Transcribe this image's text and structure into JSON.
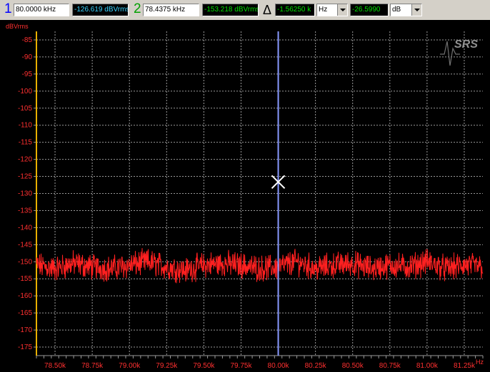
{
  "toolbar": {
    "cursor1": {
      "number": "1",
      "x_value": "80.0000 kHz",
      "y_value": "-126.619 dBVrms"
    },
    "cursor2": {
      "number": "2",
      "x_value": "78.4375 kHz",
      "y_value": "-153.218 dBVrms"
    },
    "delta": {
      "symbol": "Δ",
      "x_value": "-1.56250 k",
      "x_unit": "Hz",
      "y_value": "-26.5990",
      "y_unit": "dB"
    }
  },
  "logo": {
    "text": "SRS"
  },
  "colors": {
    "trace": "#ff2020",
    "grid": "#9a9a9a",
    "cursor_line": "#8899ff",
    "axis_text": "#ff3030",
    "yaxis_line": "#e8b000",
    "cursor1": "#0000ff",
    "cursor2": "#00aa00"
  },
  "chart_data": {
    "type": "line",
    "ylabel": "dBVrms",
    "xlabel": "Hz",
    "xlim": [
      78375,
      81375
    ],
    "ylim": [
      -177.5,
      -82.5
    ],
    "yticks": [
      -85,
      -90,
      -95,
      -100,
      -105,
      -110,
      -115,
      -120,
      -125,
      -130,
      -135,
      -140,
      -145,
      -150,
      -155,
      -160,
      -165,
      -170,
      -175
    ],
    "ytick_labels": [
      "-85",
      "-90",
      "-95",
      "-100",
      "-105",
      "-110",
      "-115",
      "-120",
      "-125",
      "-130",
      "-135",
      "-140",
      "-145",
      "-150",
      "-155",
      "-160",
      "-165",
      "-170",
      "-175"
    ],
    "xticks": [
      78500,
      78750,
      79000,
      79250,
      79500,
      79750,
      80000,
      80250,
      80500,
      80750,
      81000,
      81250
    ],
    "xtick_labels": [
      "78.50k",
      "78.75k",
      "79.00k",
      "79.25k",
      "79.50k",
      "79.75k",
      "80.00k",
      "80.25k",
      "80.50k",
      "80.75k",
      "81.00k",
      "81.25k"
    ],
    "grid": true,
    "series": [
      {
        "x": [
          78375,
          78500,
          78625,
          78750,
          78875,
          79000,
          79125,
          79250,
          79375,
          79500,
          79625,
          79750,
          79875,
          80000,
          80125,
          80250,
          80375,
          80500,
          80625,
          80750,
          80875,
          81000,
          81125,
          81250,
          81375
        ],
        "y": [
          -151,
          -152,
          -150.5,
          -151.5,
          -152,
          -151,
          -150,
          -151.5,
          -152.5,
          -151,
          -150.5,
          -151,
          -152,
          -151.5,
          -150,
          -152,
          -151,
          -150.5,
          -152,
          -151,
          -151.5,
          -150,
          -152,
          -151,
          -151.5
        ]
      }
    ],
    "cursor": {
      "x": 80000,
      "y": -126.619
    }
  }
}
